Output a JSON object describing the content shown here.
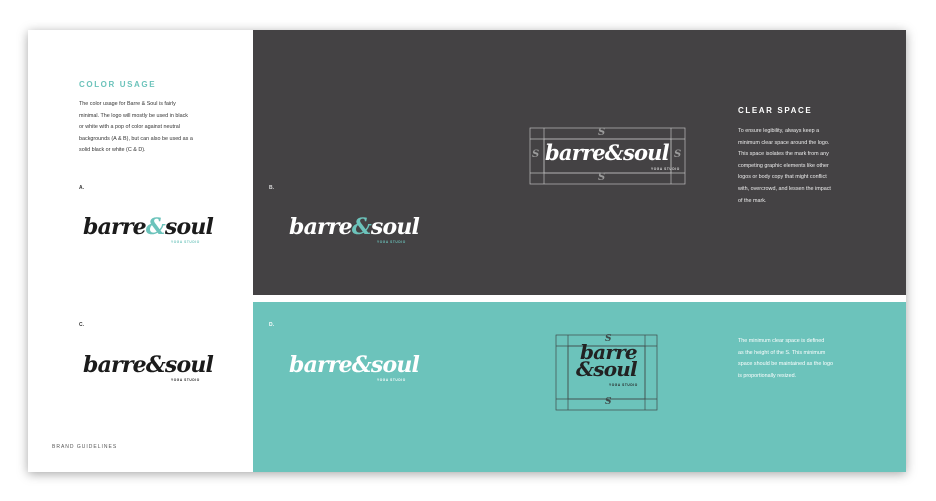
{
  "left_panel": {
    "title": "COLOR USAGE",
    "body_lines": [
      "The color usage for Barre & Soul is fairly",
      "minimal. The logo will mostly be used in black",
      "or white with a pop of color against neutral",
      "backgrounds (A & B), but can also be used as a",
      "solid black or white (C & D)."
    ],
    "label_a": "A.",
    "label_c": "C.",
    "footer": "BRAND GUIDELINES"
  },
  "logo": {
    "word1": "barre",
    "amp": "&",
    "word2": "soul",
    "sub": "YOGA STUDIO"
  },
  "labels": {
    "b": "B.",
    "d": "D."
  },
  "clear_space": {
    "title": "CLEAR SPACE",
    "body_lines": [
      "To ensure legibility, always keep a",
      "minimum clear space around the logo.",
      "This space isolates the mark from any",
      "competing graphic elements like other",
      "logos or body copy that might conflict",
      "with, overcrowd, and lessen the impact",
      "of the mark."
    ],
    "min_lines": [
      "The minimum clear space is defined",
      "as the height of the S. This minimum",
      "space should be maintained as the logo",
      "is proportionally resized."
    ],
    "s_glyph": "S"
  },
  "colors": {
    "teal": "#6cc3bb",
    "charcoal": "#444244",
    "black": "#1b1b1b",
    "white": "#ffffff"
  }
}
